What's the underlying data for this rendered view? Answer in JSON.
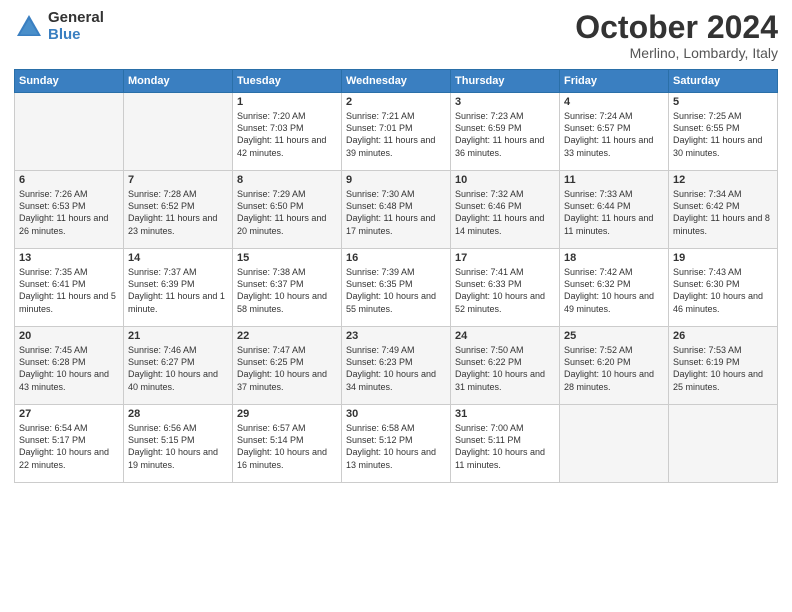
{
  "logo": {
    "general": "General",
    "blue": "Blue"
  },
  "title": "October 2024",
  "location": "Merlino, Lombardy, Italy",
  "headers": [
    "Sunday",
    "Monday",
    "Tuesday",
    "Wednesday",
    "Thursday",
    "Friday",
    "Saturday"
  ],
  "weeks": [
    [
      {
        "day": "",
        "sunrise": "",
        "sunset": "",
        "daylight": ""
      },
      {
        "day": "",
        "sunrise": "",
        "sunset": "",
        "daylight": ""
      },
      {
        "day": "1",
        "sunrise": "Sunrise: 7:20 AM",
        "sunset": "Sunset: 7:03 PM",
        "daylight": "Daylight: 11 hours and 42 minutes."
      },
      {
        "day": "2",
        "sunrise": "Sunrise: 7:21 AM",
        "sunset": "Sunset: 7:01 PM",
        "daylight": "Daylight: 11 hours and 39 minutes."
      },
      {
        "day": "3",
        "sunrise": "Sunrise: 7:23 AM",
        "sunset": "Sunset: 6:59 PM",
        "daylight": "Daylight: 11 hours and 36 minutes."
      },
      {
        "day": "4",
        "sunrise": "Sunrise: 7:24 AM",
        "sunset": "Sunset: 6:57 PM",
        "daylight": "Daylight: 11 hours and 33 minutes."
      },
      {
        "day": "5",
        "sunrise": "Sunrise: 7:25 AM",
        "sunset": "Sunset: 6:55 PM",
        "daylight": "Daylight: 11 hours and 30 minutes."
      }
    ],
    [
      {
        "day": "6",
        "sunrise": "Sunrise: 7:26 AM",
        "sunset": "Sunset: 6:53 PM",
        "daylight": "Daylight: 11 hours and 26 minutes."
      },
      {
        "day": "7",
        "sunrise": "Sunrise: 7:28 AM",
        "sunset": "Sunset: 6:52 PM",
        "daylight": "Daylight: 11 hours and 23 minutes."
      },
      {
        "day": "8",
        "sunrise": "Sunrise: 7:29 AM",
        "sunset": "Sunset: 6:50 PM",
        "daylight": "Daylight: 11 hours and 20 minutes."
      },
      {
        "day": "9",
        "sunrise": "Sunrise: 7:30 AM",
        "sunset": "Sunset: 6:48 PM",
        "daylight": "Daylight: 11 hours and 17 minutes."
      },
      {
        "day": "10",
        "sunrise": "Sunrise: 7:32 AM",
        "sunset": "Sunset: 6:46 PM",
        "daylight": "Daylight: 11 hours and 14 minutes."
      },
      {
        "day": "11",
        "sunrise": "Sunrise: 7:33 AM",
        "sunset": "Sunset: 6:44 PM",
        "daylight": "Daylight: 11 hours and 11 minutes."
      },
      {
        "day": "12",
        "sunrise": "Sunrise: 7:34 AM",
        "sunset": "Sunset: 6:42 PM",
        "daylight": "Daylight: 11 hours and 8 minutes."
      }
    ],
    [
      {
        "day": "13",
        "sunrise": "Sunrise: 7:35 AM",
        "sunset": "Sunset: 6:41 PM",
        "daylight": "Daylight: 11 hours and 5 minutes."
      },
      {
        "day": "14",
        "sunrise": "Sunrise: 7:37 AM",
        "sunset": "Sunset: 6:39 PM",
        "daylight": "Daylight: 11 hours and 1 minute."
      },
      {
        "day": "15",
        "sunrise": "Sunrise: 7:38 AM",
        "sunset": "Sunset: 6:37 PM",
        "daylight": "Daylight: 10 hours and 58 minutes."
      },
      {
        "day": "16",
        "sunrise": "Sunrise: 7:39 AM",
        "sunset": "Sunset: 6:35 PM",
        "daylight": "Daylight: 10 hours and 55 minutes."
      },
      {
        "day": "17",
        "sunrise": "Sunrise: 7:41 AM",
        "sunset": "Sunset: 6:33 PM",
        "daylight": "Daylight: 10 hours and 52 minutes."
      },
      {
        "day": "18",
        "sunrise": "Sunrise: 7:42 AM",
        "sunset": "Sunset: 6:32 PM",
        "daylight": "Daylight: 10 hours and 49 minutes."
      },
      {
        "day": "19",
        "sunrise": "Sunrise: 7:43 AM",
        "sunset": "Sunset: 6:30 PM",
        "daylight": "Daylight: 10 hours and 46 minutes."
      }
    ],
    [
      {
        "day": "20",
        "sunrise": "Sunrise: 7:45 AM",
        "sunset": "Sunset: 6:28 PM",
        "daylight": "Daylight: 10 hours and 43 minutes."
      },
      {
        "day": "21",
        "sunrise": "Sunrise: 7:46 AM",
        "sunset": "Sunset: 6:27 PM",
        "daylight": "Daylight: 10 hours and 40 minutes."
      },
      {
        "day": "22",
        "sunrise": "Sunrise: 7:47 AM",
        "sunset": "Sunset: 6:25 PM",
        "daylight": "Daylight: 10 hours and 37 minutes."
      },
      {
        "day": "23",
        "sunrise": "Sunrise: 7:49 AM",
        "sunset": "Sunset: 6:23 PM",
        "daylight": "Daylight: 10 hours and 34 minutes."
      },
      {
        "day": "24",
        "sunrise": "Sunrise: 7:50 AM",
        "sunset": "Sunset: 6:22 PM",
        "daylight": "Daylight: 10 hours and 31 minutes."
      },
      {
        "day": "25",
        "sunrise": "Sunrise: 7:52 AM",
        "sunset": "Sunset: 6:20 PM",
        "daylight": "Daylight: 10 hours and 28 minutes."
      },
      {
        "day": "26",
        "sunrise": "Sunrise: 7:53 AM",
        "sunset": "Sunset: 6:19 PM",
        "daylight": "Daylight: 10 hours and 25 minutes."
      }
    ],
    [
      {
        "day": "27",
        "sunrise": "Sunrise: 6:54 AM",
        "sunset": "Sunset: 5:17 PM",
        "daylight": "Daylight: 10 hours and 22 minutes."
      },
      {
        "day": "28",
        "sunrise": "Sunrise: 6:56 AM",
        "sunset": "Sunset: 5:15 PM",
        "daylight": "Daylight: 10 hours and 19 minutes."
      },
      {
        "day": "29",
        "sunrise": "Sunrise: 6:57 AM",
        "sunset": "Sunset: 5:14 PM",
        "daylight": "Daylight: 10 hours and 16 minutes."
      },
      {
        "day": "30",
        "sunrise": "Sunrise: 6:58 AM",
        "sunset": "Sunset: 5:12 PM",
        "daylight": "Daylight: 10 hours and 13 minutes."
      },
      {
        "day": "31",
        "sunrise": "Sunrise: 7:00 AM",
        "sunset": "Sunset: 5:11 PM",
        "daylight": "Daylight: 10 hours and 11 minutes."
      },
      {
        "day": "",
        "sunrise": "",
        "sunset": "",
        "daylight": ""
      },
      {
        "day": "",
        "sunrise": "",
        "sunset": "",
        "daylight": ""
      }
    ]
  ]
}
